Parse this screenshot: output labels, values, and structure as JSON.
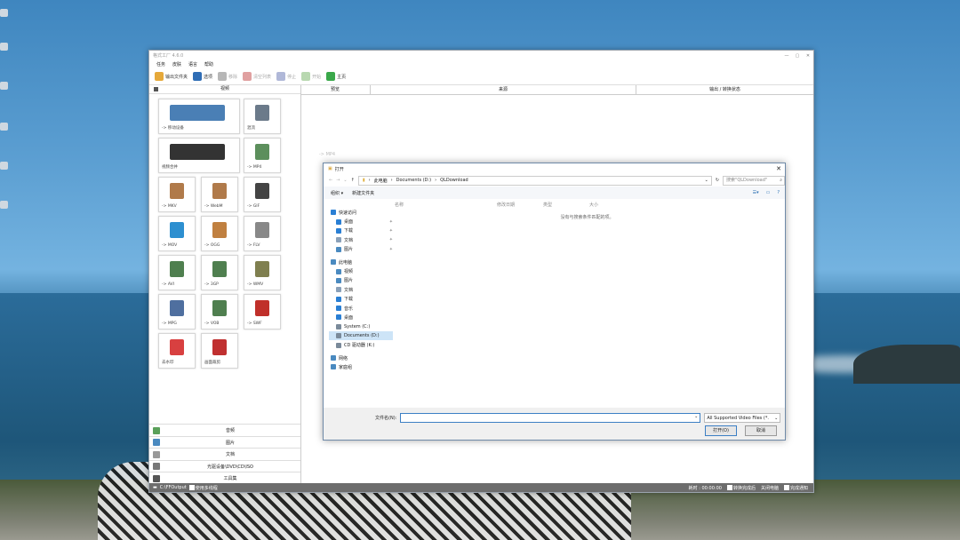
{
  "app": {
    "title": "格式工厂 4.6.0",
    "window_controls": [
      "—",
      "▢",
      "✕"
    ],
    "menu": [
      "任务",
      "皮肤",
      "语言",
      "帮助"
    ],
    "toolbar": [
      {
        "label": "输出文件夹",
        "icon": "folder-icon",
        "enabled": true,
        "color": "#e6a93a"
      },
      {
        "label": "选项",
        "icon": "options-icon",
        "enabled": true,
        "color": "#2f6db5"
      },
      {
        "label": "移除",
        "icon": "remove-icon",
        "enabled": false,
        "color": "#b7b7b7"
      },
      {
        "label": "清空列表",
        "icon": "clear-icon",
        "enabled": false,
        "color": "#e0a0a0"
      },
      {
        "label": "停止",
        "icon": "stop-icon",
        "enabled": false,
        "color": "#b0b8d8"
      },
      {
        "label": "开始",
        "icon": "start-icon",
        "enabled": false,
        "color": "#b8d8b0"
      },
      {
        "label": "主页",
        "icon": "home-icon",
        "enabled": true,
        "color": "#3aa84a"
      }
    ],
    "left_header": "视频",
    "tiles": [
      {
        "label": "-> 移动设备",
        "icon": "mobile-device-icon",
        "color": "#4a7fb5"
      },
      {
        "label": "混流",
        "icon": "mux-icon",
        "color": "#6b7a8a"
      },
      {
        "label": "视频合并",
        "icon": "video-join-icon",
        "color": "#333333"
      },
      {
        "label": "-> MP4",
        "icon": "mp4-icon",
        "color": "#5c8f5c"
      },
      {
        "label": "-> MKV",
        "icon": "mkv-icon",
        "color": "#b07a4a"
      },
      {
        "label": "-> WebM",
        "icon": "webm-icon",
        "color": "#b07a4a"
      },
      {
        "label": "-> GIF",
        "icon": "gif-icon",
        "color": "#444444"
      },
      {
        "label": "-> MOV",
        "icon": "mov-icon",
        "color": "#2d8fd0"
      },
      {
        "label": "-> OGG",
        "icon": "ogg-icon",
        "color": "#c08040"
      },
      {
        "label": "-> FLV",
        "icon": "flv-icon",
        "color": "#888888"
      },
      {
        "label": "-> AVI",
        "icon": "avi-icon",
        "color": "#4f7f4f"
      },
      {
        "label": "-> 3GP",
        "icon": "3gp-icon",
        "color": "#4f7f4f"
      },
      {
        "label": "-> WMV",
        "icon": "wmv-icon",
        "color": "#7f7f4f"
      },
      {
        "label": "-> MPG",
        "icon": "mpg-icon",
        "color": "#4f6f9f"
      },
      {
        "label": "-> VOB",
        "icon": "vob-icon",
        "color": "#4f7f4f"
      },
      {
        "label": "-> SWF",
        "icon": "swf-icon",
        "color": "#c0302a"
      },
      {
        "label": "去水印",
        "icon": "watermark-remove-icon",
        "color": "#d84040"
      },
      {
        "label": "画面裁剪",
        "icon": "crop-icon",
        "color": "#c03030"
      }
    ],
    "categories": [
      {
        "label": "音频",
        "icon": "audio-icon",
        "color": "#5aa05a"
      },
      {
        "label": "图片",
        "icon": "image-icon",
        "color": "#4a8ac0"
      },
      {
        "label": "文档",
        "icon": "document-icon",
        "color": "#999999"
      },
      {
        "label": "光驱设备\\DVD\\CD\\ISO",
        "icon": "disc-icon",
        "color": "#777777"
      },
      {
        "label": "工具集",
        "icon": "tools-icon",
        "color": "#555555"
      }
    ],
    "columns": [
      "预览",
      "来源",
      "输出 / 转换状态"
    ],
    "status": {
      "output_path": "C:\\FFOutput",
      "multithread_label": "使用多线程",
      "elapsed_label": "耗时 : 00:00:00",
      "after_done_label": "转换完成后",
      "shutdown_label": "关闭电脑",
      "notify_label": "完成通知"
    }
  },
  "ghost_window": {
    "title": "-> MP4"
  },
  "dialog": {
    "title": "打开",
    "path_parts": [
      "此电脑",
      "Documents (D:)",
      "QLDownload"
    ],
    "search_placeholder": "搜索\"QLDownload\"",
    "organize_label": "组织 ▾",
    "new_folder_label": "新建文件夹",
    "nav_items": [
      {
        "label": "快速访问",
        "icon": "star-icon",
        "color": "#2a7fd4",
        "pinned": false,
        "level": 0,
        "selected": false
      },
      {
        "label": "桌面",
        "icon": "desktop-icon",
        "color": "#2a7fd4",
        "pinned": true,
        "level": 1,
        "selected": false
      },
      {
        "label": "下载",
        "icon": "download-icon",
        "color": "#2a7fd4",
        "pinned": true,
        "level": 1,
        "selected": false
      },
      {
        "label": "文档",
        "icon": "documents-icon",
        "color": "#8aa0b8",
        "pinned": true,
        "level": 1,
        "selected": false
      },
      {
        "label": "图片",
        "icon": "pictures-icon",
        "color": "#4a8ac0",
        "pinned": true,
        "level": 1,
        "selected": false
      },
      {
        "label": "此电脑",
        "icon": "computer-icon",
        "color": "#4a8ac0",
        "pinned": false,
        "level": 0,
        "selected": false
      },
      {
        "label": "视频",
        "icon": "videos-icon",
        "color": "#4a8ac0",
        "pinned": false,
        "level": 1,
        "selected": false
      },
      {
        "label": "图片",
        "icon": "pictures-icon",
        "color": "#4a8ac0",
        "pinned": false,
        "level": 1,
        "selected": false
      },
      {
        "label": "文档",
        "icon": "documents-icon",
        "color": "#8aa0b8",
        "pinned": false,
        "level": 1,
        "selected": false
      },
      {
        "label": "下载",
        "icon": "download-icon",
        "color": "#2a7fd4",
        "pinned": false,
        "level": 1,
        "selected": false
      },
      {
        "label": "音乐",
        "icon": "music-icon",
        "color": "#2a7fd4",
        "pinned": false,
        "level": 1,
        "selected": false
      },
      {
        "label": "桌面",
        "icon": "desktop-icon",
        "color": "#2a7fd4",
        "pinned": false,
        "level": 1,
        "selected": false
      },
      {
        "label": "System (C:)",
        "icon": "drive-icon",
        "color": "#7a8a9a",
        "pinned": false,
        "level": 1,
        "selected": false
      },
      {
        "label": "Documents (D:)",
        "icon": "drive-icon",
        "color": "#7a8a9a",
        "pinned": false,
        "level": 1,
        "selected": true
      },
      {
        "label": "CD 驱动器 (K:)",
        "icon": "cd-drive-icon",
        "color": "#7a8a9a",
        "pinned": false,
        "level": 1,
        "selected": false
      },
      {
        "label": "网络",
        "icon": "network-icon",
        "color": "#4a8ac0",
        "pinned": false,
        "level": 0,
        "selected": false
      },
      {
        "label": "家庭组",
        "icon": "homegroup-icon",
        "color": "#4a8ac0",
        "pinned": false,
        "level": 0,
        "selected": false
      }
    ],
    "file_columns": [
      "名称",
      "修改日期",
      "类型",
      "大小"
    ],
    "empty_message": "没有与搜索条件匹配的项。",
    "filename_label": "文件名(N):",
    "filename_value": "",
    "filetype_value": "All Supported Video Files (*.",
    "open_button": "打开(O)",
    "cancel_button": "取消"
  }
}
